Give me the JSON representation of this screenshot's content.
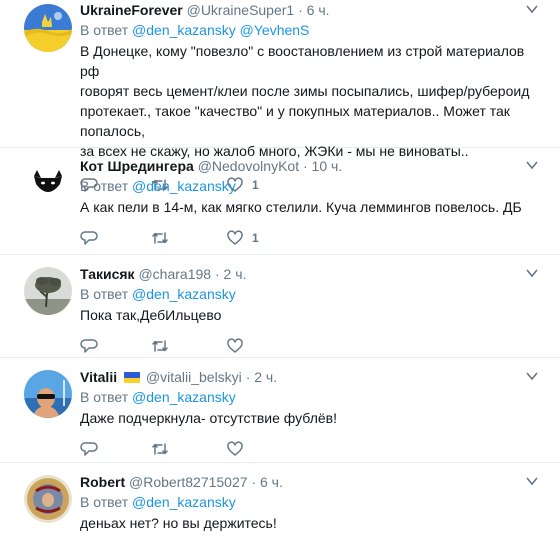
{
  "colors": {
    "accent": "#1b95e0",
    "muted": "#657786",
    "text": "#14171a",
    "border": "#e6ecf0"
  },
  "icons": [
    "reply-icon",
    "retweet-icon",
    "like-icon",
    "caret-down-icon",
    "ukraine-flag-icon"
  ],
  "tweets": [
    {
      "name": "UkraineForever",
      "handle": "@UkraineSuper1",
      "dot": "·",
      "time": "6 ч.",
      "reply_prefix": "В ответ",
      "mentions": [
        "@den_kazansky",
        "@YevhenS"
      ],
      "text_lines": [
        "В Донецке, кому \"повезло\" с воостановлением из строй материалов рф",
        "говорят весь цемент/клеи после зимы посыпались, шифер/рубероид",
        "протекает., такое \"качество\" и у покупных материалов.. Может так попалось,",
        "за всех не скажу, но жалоб много, ЖЭКи - мы не виноваты.."
      ],
      "like_count": "1"
    },
    {
      "name": "Кот Шредингера",
      "handle": "@NedovolnyKot",
      "dot": "·",
      "time": "10 ч.",
      "reply_prefix": "В ответ",
      "mentions": [
        "@den_kazansky"
      ],
      "text_lines": [
        "А как пели в 14-м, как мягко стелили. Куча леммингов повелось. ДБ"
      ],
      "like_count": "1"
    },
    {
      "name": "Такисяк",
      "handle": "@chara198",
      "dot": "·",
      "time": "2 ч.",
      "reply_prefix": "В ответ",
      "mentions": [
        "@den_kazansky"
      ],
      "text_lines": [
        "Пока так,ДебИльцево"
      ],
      "like_count": ""
    },
    {
      "name": "Vitalii",
      "handle": "@vitalii_belskyi",
      "dot": "·",
      "time": "2 ч.",
      "reply_prefix": "В ответ",
      "mentions": [
        "@den_kazansky"
      ],
      "text_lines": [
        "Даже подчеркнула- отсутствие фублёв!"
      ],
      "like_count": ""
    },
    {
      "name": "Robert",
      "handle": "@Robert82715027",
      "dot": "·",
      "time": "6 ч.",
      "reply_prefix": "В ответ",
      "mentions": [
        "@den_kazansky"
      ],
      "text_lines": [
        "деньах нет? но вы держитесь!"
      ],
      "like_count": ""
    }
  ]
}
